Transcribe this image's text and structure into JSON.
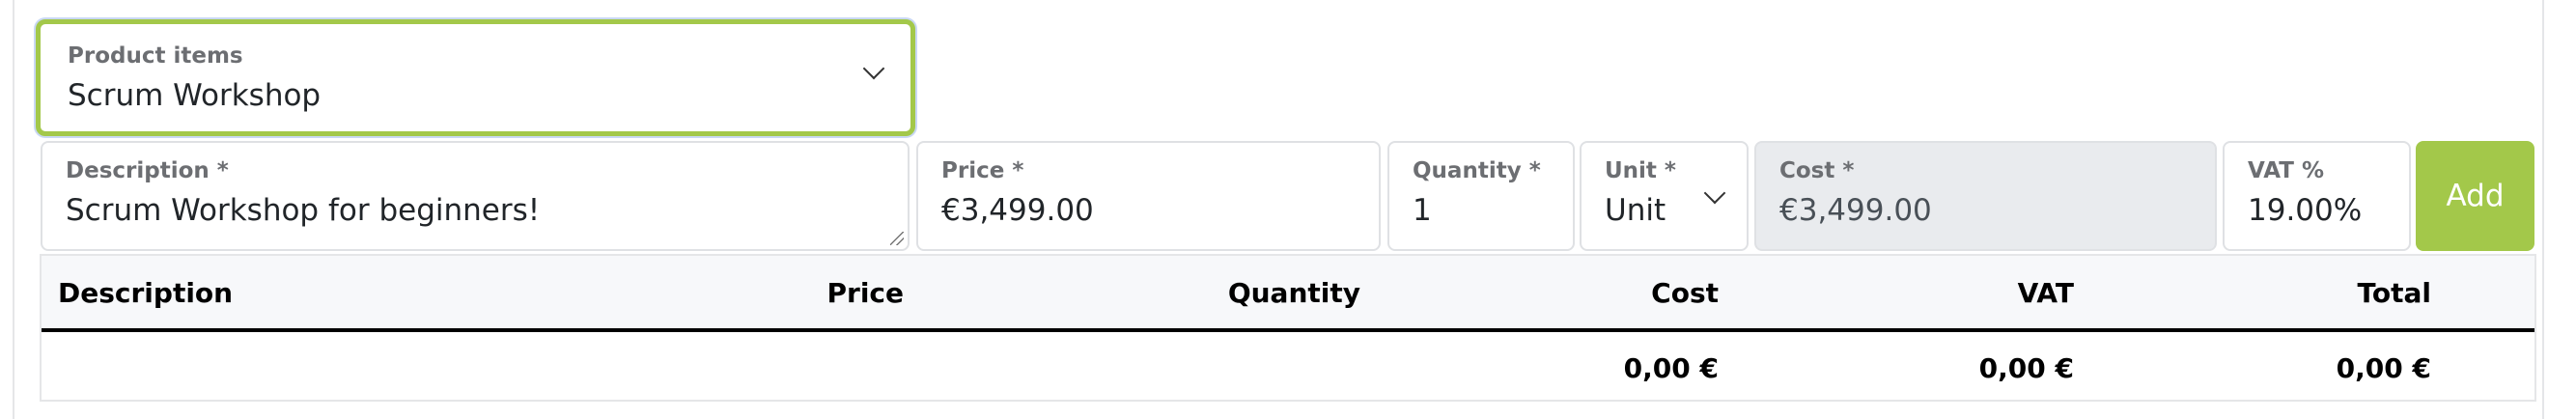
{
  "product_select": {
    "label": "Product items",
    "value": "Scrum Workshop"
  },
  "form": {
    "description": {
      "label": "Description *",
      "value": "Scrum Workshop for beginners!"
    },
    "price": {
      "label": "Price *",
      "value": "€3,499.00"
    },
    "quantity": {
      "label": "Quantity *",
      "value": "1"
    },
    "unit": {
      "label": "Unit *",
      "value": "Unit"
    },
    "cost": {
      "label": "Cost *",
      "value": "€3,499.00"
    },
    "vat": {
      "label": "VAT %",
      "value": "19.00%"
    },
    "add_label": "Add"
  },
  "table": {
    "headers": [
      "Description",
      "Price",
      "Quantity",
      "Cost",
      "VAT",
      "Total"
    ],
    "totals": {
      "cost": "0,00 €",
      "vat": "0,00 €",
      "total": "0,00 €"
    }
  },
  "colors": {
    "accent": "#a3c84a",
    "disabled_bg": "#e9ebee"
  }
}
